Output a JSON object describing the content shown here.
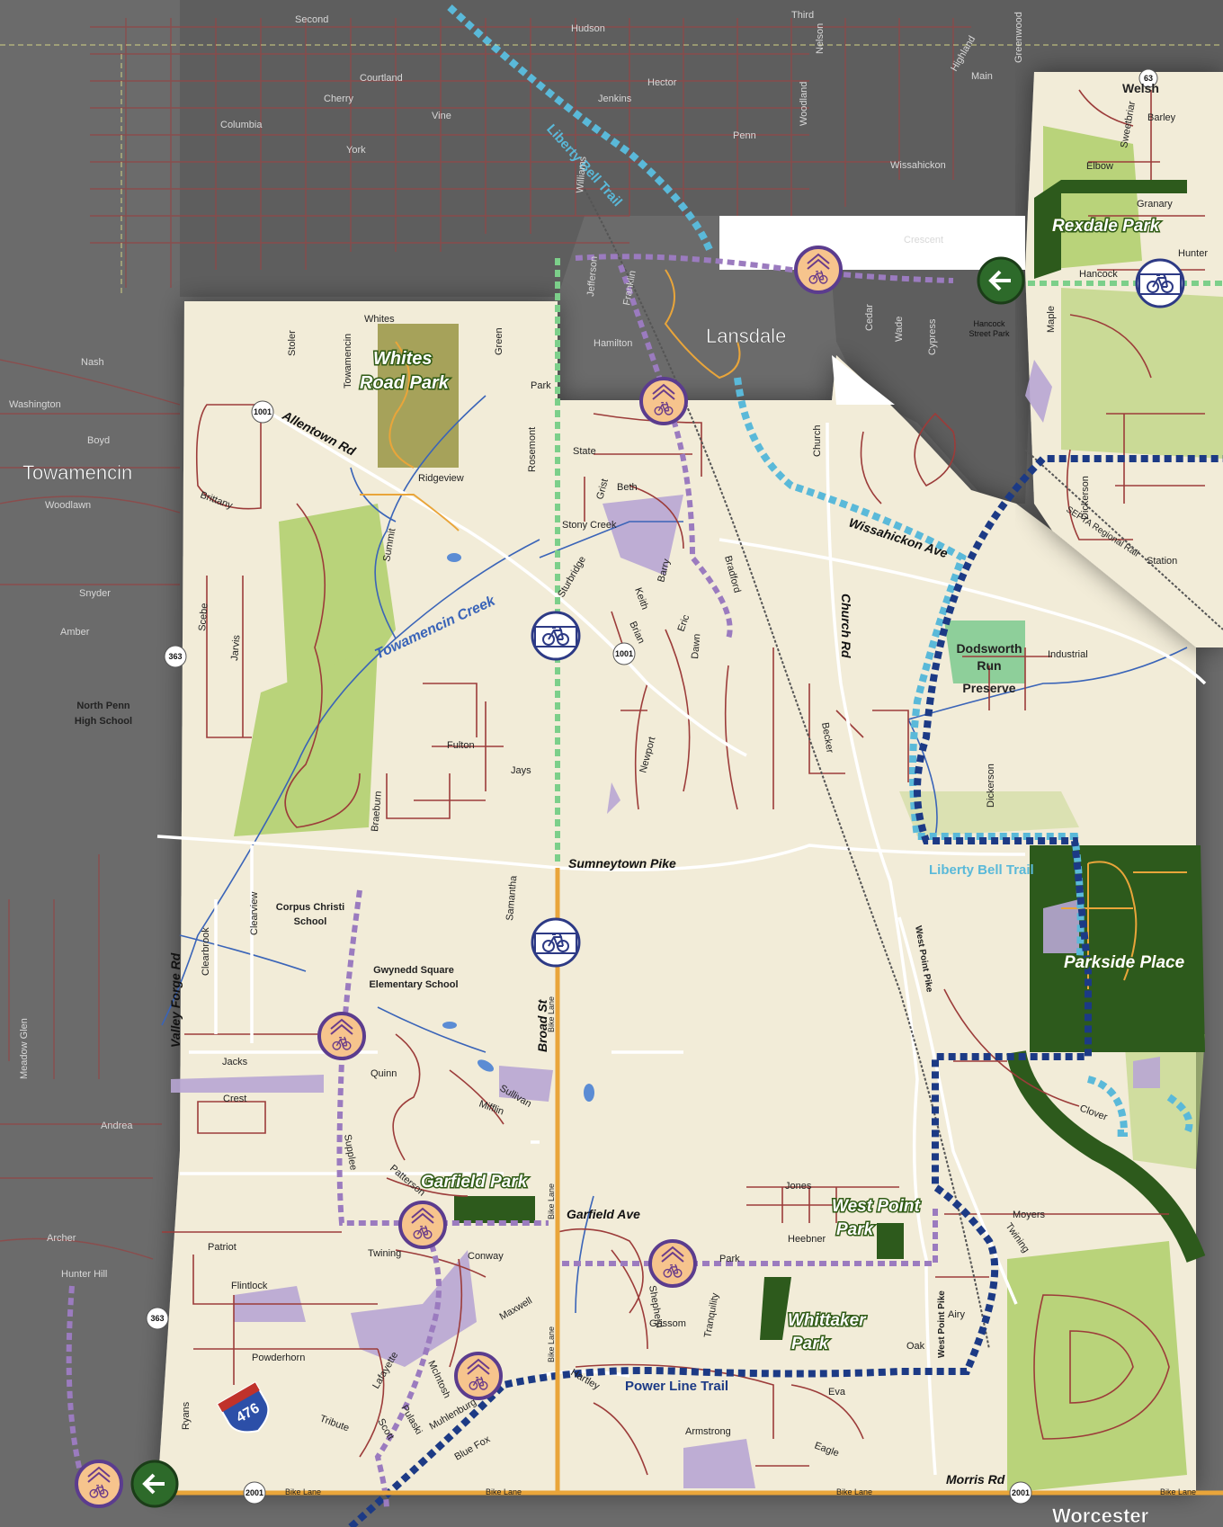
{
  "municipalities": {
    "towamencin": "Towamencin",
    "lansdale": "Lansdale",
    "worcester": "Worcester"
  },
  "parks": {
    "whites_road_park": [
      "Whites",
      "Road Park"
    ],
    "rexdale_park": "Rexdale Park",
    "garfield_park": "Garfield Park",
    "west_point_park": [
      "West Point",
      "Park"
    ],
    "whittaker_park": [
      "Whittaker",
      "Park"
    ],
    "parkside_place": "Parkside Place",
    "dodsworth": [
      "Dodsworth",
      "Run",
      "Preserve"
    ],
    "hancock_street_park": [
      "Hancock",
      "Street Park"
    ]
  },
  "trails": {
    "liberty_bell_trail": "Liberty Bell Trail",
    "power_line_trail": "Power Line Trail",
    "bike_lane": "Bike Lane"
  },
  "water": {
    "towamencin_creek": "Towamencin Creek"
  },
  "schools": {
    "north_penn": [
      "North Penn",
      "High School"
    ],
    "corpus_christi": [
      "Corpus Christi",
      "School"
    ],
    "gwynedd_square": [
      "Gwynedd Square",
      "Elementary School"
    ]
  },
  "major_roads": {
    "sumneytown_pike": "Sumneytown Pike",
    "broad_st": "Broad St",
    "church_rd": "Church Rd",
    "valley_forge_rd": "Valley Forge Rd",
    "wissahickon_ave": "Wissahickon Ave",
    "garfield_ave": "Garfield Ave",
    "allentown_rd": "Allentown Rd",
    "morris_rd": "Morris Rd",
    "west_point_pike": "West Point Pike",
    "septa": "SEPTA Regional Rail"
  },
  "route_shields": {
    "r1001": "1001",
    "r363": "363",
    "r2001": "2001",
    "r63": "63",
    "i476": "476"
  },
  "street_labels": {
    "whites": "Whites",
    "stoler": "Stoler",
    "towamencin_st": "Towamencin",
    "green": "Green",
    "park": "Park",
    "ridgeview": "Ridgeview",
    "brittany": "Brittany",
    "summit": "Summit",
    "rosemont": "Rosemont",
    "state": "State",
    "beth": "Beth",
    "grist": "Grist",
    "stony_creek": "Stony Creek",
    "sturbridge": "Sturbridge",
    "keith": "Keith",
    "barry": "Barry",
    "brian": "Brian",
    "eric": "Eric",
    "dawn": "Dawn",
    "bradford": "Bradford",
    "newport": "Newport",
    "jays": "Jays",
    "fulton": "Fulton",
    "braeburn": "Braeburn",
    "scebe": "Scebe",
    "jarvis": "Jarvis",
    "samantha": "Samantha",
    "becker": "Becker",
    "dickerson": "Dickerson",
    "industrial": "Industrial",
    "station": "Station",
    "church": "Church",
    "clearview": "Clearview",
    "clearbrook": "Clearbrook",
    "jacks": "Jacks",
    "quinn": "Quinn",
    "crest": "Crest",
    "sullivan": "Sullivan",
    "mifflin": "Mifflin",
    "supplee": "Supplee",
    "patterson": "Patterson",
    "twining": "Twining",
    "conway": "Conway",
    "patriot": "Patriot",
    "flintlock": "Flintlock",
    "maxwell": "Maxwell",
    "powderhorn": "Powderhorn",
    "lafayette": "Lafayette",
    "mcintosh": "McIntosh",
    "pulaski": "Pulaski",
    "scott": "Scott",
    "muhlenburg": "Muhlenburg",
    "tribute": "Tribute",
    "blue_fox": "Blue Fox",
    "ryans": "Ryans",
    "jones": "Jones",
    "heebner": "Heebner",
    "sheperd": "Shepherd",
    "grissom": "Grissom",
    "tranquility": "Tranquility",
    "hartley": "Hartley",
    "armstrong": "Armstrong",
    "eva": "Eva",
    "eagle": "Eagle",
    "airy": "Airy",
    "oak": "Oak",
    "moyers": "Moyers",
    "clover": "Clover",
    "welsh": "Welsh",
    "barley": "Barley",
    "elbow": "Elbow",
    "sweetbriar": "Sweetbriar",
    "granary": "Granary",
    "hunter": "Hunter",
    "hancock": "Hancock",
    "maple": "Maple",
    "crescent": "Crescent",
    "wissahickon": "Wissahickon",
    "main": "Main",
    "penn": "Penn",
    "hector": "Hector",
    "jenkins": "Jenkins",
    "hudson": "Hudson",
    "second": "Second",
    "third": "Third",
    "vine": "Vine",
    "york": "York",
    "columbia": "Columbia",
    "cherry": "Cherry",
    "courtland": "Courtland",
    "jefferson": "Jefferson",
    "hamilton": "Hamilton",
    "franklin": "Franklin",
    "williams": "Williams",
    "nash": "Nash",
    "washington": "Washington",
    "boyd": "Boyd",
    "woodlawn": "Woodlawn",
    "snyder": "Snyder",
    "amber": "Amber",
    "meadow_glen": "Meadow Glen",
    "archer": "Archer",
    "hunter_hill": "Hunter Hill",
    "andrea": "Andrea",
    "nelson": "Nelson",
    "highland": "Highland",
    "woodland": "Woodland",
    "cedar": "Cedar",
    "wade": "Wade",
    "cypress": "Cypress",
    "greenwood": "Greenwood",
    "sherlock": "Sherlock",
    "wheaton": "Wheaton"
  },
  "colors": {
    "base_land": "#f2ecd8",
    "outside_gray": "#6b6b6b",
    "road_local": "#9c3c3a",
    "road_major": "#ffffff",
    "park_light": "#b9d37a",
    "park_dark": "#2d5a1c",
    "open_space": "#b8a6d4",
    "creek": "#3a64b8",
    "liberty_bell_trail": "#5ab9d9",
    "power_line_trail": "#1c3a85",
    "proposed_sharrow": "#9b7bbf",
    "bike_lane": "#e9a53a",
    "green_route": "#7ccf8a"
  },
  "icons": [
    "bike-lane-icon",
    "sharrow-bike-icon",
    "trail-arrow-icon",
    "interstate-shield-icon",
    "route-shield-icon"
  ]
}
